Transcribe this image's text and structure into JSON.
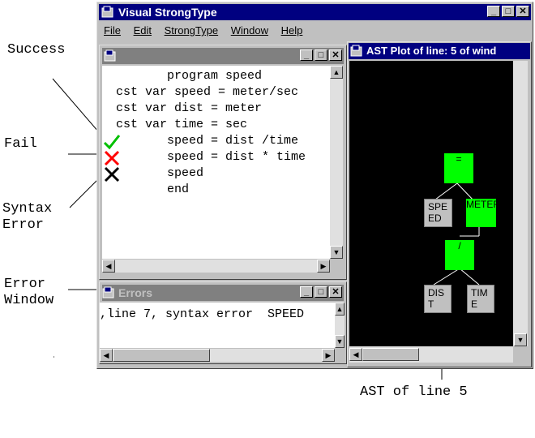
{
  "annotations": {
    "success": "Success",
    "fail": "Fail",
    "syntax_error": "Syntax\nError",
    "error_window": "Error\nWindow",
    "ast_caption": "AST of line 5"
  },
  "app": {
    "title": "Visual StrongType",
    "menu": [
      "File",
      "Edit",
      "StrongType",
      "Window",
      "Help"
    ]
  },
  "editor": {
    "lines": [
      "       program speed",
      "cst var speed = meter/sec",
      "cst var dist = meter",
      "cst var time = sec",
      "       speed = dist /time",
      "       speed = dist * time",
      "       speed",
      "       end"
    ]
  },
  "errors": {
    "title": "Errors",
    "message": ",line 7, syntax error  SPEED"
  },
  "ast": {
    "title": "AST Plot of line:  5 of wind",
    "nodes": {
      "root": "=",
      "left": "SPE\nED",
      "right": "METER",
      "div": "/",
      "dist": "DIS\nT",
      "time": "TIM\nE"
    }
  },
  "colors": {
    "title_active": "#000080",
    "title_inactive": "#808080",
    "ast_background": "#000000",
    "ast_node": "#00ff00",
    "check_ok": "#00c000",
    "cross_fail": "#ff0000",
    "cross_syntax": "#000000"
  }
}
